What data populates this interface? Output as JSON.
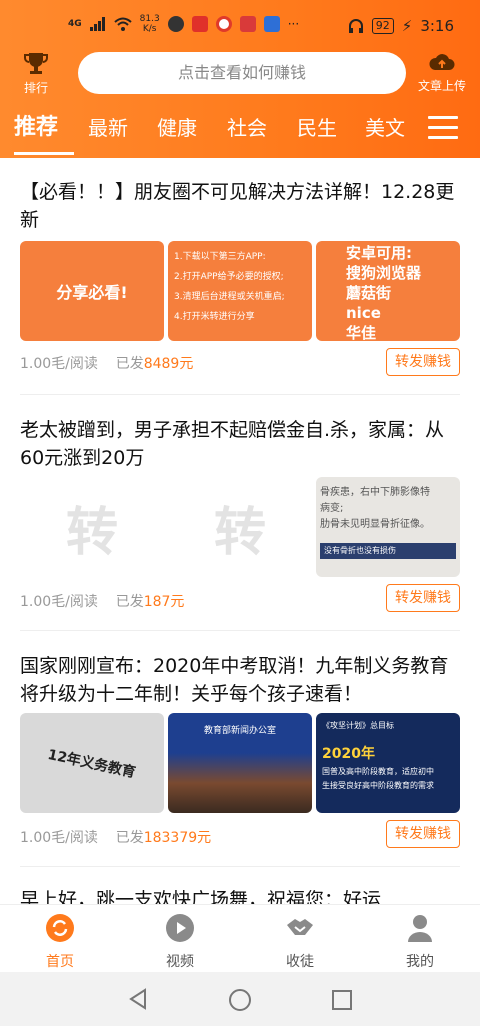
{
  "status_bar": {
    "network": "4G",
    "speed": "81.3\nK/s",
    "battery": "92",
    "time": "3:16"
  },
  "topbar": {
    "rank_label": "排行",
    "search_placeholder": "点击查看如何赚钱",
    "upload_label": "文章上传"
  },
  "tabs": [
    "推荐",
    "最新",
    "健康",
    "社会",
    "民生",
    "美文"
  ],
  "articles": [
    {
      "title": "【必看！！】朋友圈不可见解决方法详解！12.28更新",
      "thumbs": [
        {
          "text": "分享必看!"
        },
        {
          "lines": [
            "1.下载以下第三方APP:",
            "2.打开APP给予必要的授权;",
            "3.清理后台进程或关机重启;",
            "4.打开米转进行分享"
          ]
        },
        {
          "lines": [
            "安卓可用:",
            "搜狗浏览器",
            "蘑菇街",
            "nice",
            "华佳"
          ]
        }
      ],
      "rate": "1.00毛/阅读",
      "sent_prefix": "已发",
      "sent_count": "8489元",
      "forward": "转发赚钱"
    },
    {
      "title": "老太被蹭到，男子承担不起赔偿金自.杀，家属：从60元涨到20万",
      "thumbs": [
        {
          "text": "转"
        },
        {
          "text": "转"
        },
        {
          "lines": [
            "骨疾患，右中下肺影像特",
            "病变;",
            "肋骨未见明显骨折征像。",
            "没有骨折也没有损伤"
          ]
        }
      ],
      "rate": "1.00毛/阅读",
      "sent_prefix": "已发",
      "sent_count": "187元",
      "forward": "转发赚钱"
    },
    {
      "title": "国家刚刚宣布：2020年中考取消！九年制义务教育将升级为十二年制！关乎每个孩子速看！",
      "thumbs": [
        {
          "text": "12年义务教育"
        },
        {
          "text": "教育部新闻办公室"
        },
        {
          "lines": [
            "《攻坚计划》总目标",
            "2020年",
            "国普及高中阶段教育，适应初中",
            "生接受良好高中阶段教育的需求"
          ]
        }
      ],
      "rate": "1.00毛/阅读",
      "sent_prefix": "已发",
      "sent_count": "183379元",
      "forward": "转发赚钱"
    },
    {
      "title": "早上好，跳一支欢快广场舞，祝福您：好运"
    }
  ],
  "bottom_nav": [
    "首页",
    "视频",
    "收徒",
    "我的"
  ]
}
